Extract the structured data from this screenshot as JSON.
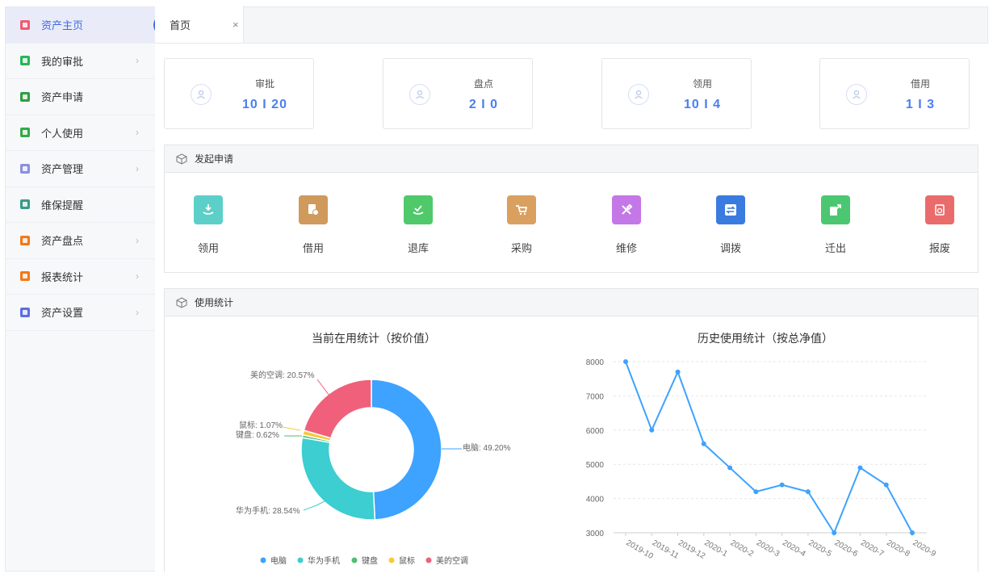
{
  "sidebar": {
    "items": [
      {
        "label": "资产主页",
        "color": "#f05b72",
        "has_chevron": false,
        "active": true
      },
      {
        "label": "我的审批",
        "color": "#27b55b",
        "has_chevron": true
      },
      {
        "label": "资产申请",
        "color": "#2f9e44",
        "has_chevron": false
      },
      {
        "label": "个人使用",
        "color": "#37a84a",
        "has_chevron": true
      },
      {
        "label": "资产管理",
        "color": "#8a8fe0",
        "has_chevron": true
      },
      {
        "label": "维保提醒",
        "color": "#3a9a8a",
        "has_chevron": false
      },
      {
        "label": "资产盘点",
        "color": "#f07a1a",
        "has_chevron": true
      },
      {
        "label": "报表统计",
        "color": "#f07a1a",
        "has_chevron": true
      },
      {
        "label": "资产设置",
        "color": "#5a6fe0",
        "has_chevron": true
      }
    ],
    "accent": "#4169e1"
  },
  "tabs": [
    {
      "title": "首页",
      "close": "×"
    }
  ],
  "stats": [
    {
      "label": "审批",
      "value": "10 I 20"
    },
    {
      "label": "盘点",
      "value": "2 I 0"
    },
    {
      "label": "领用",
      "value": "10 I 4"
    },
    {
      "label": "借用",
      "value": "1 I 3"
    }
  ],
  "apply_panel": {
    "title": "发起申请",
    "items": [
      {
        "label": "领用",
        "color": "#5ccfc8",
        "icon": "download-hand-icon"
      },
      {
        "label": "借用",
        "color": "#cf9a5c",
        "icon": "document-clock-icon"
      },
      {
        "label": "退库",
        "color": "#4fc96a",
        "icon": "return-hand-icon"
      },
      {
        "label": "采购",
        "color": "#d9a060",
        "icon": "cart-icon"
      },
      {
        "label": "维修",
        "color": "#c477e6",
        "icon": "tools-icon"
      },
      {
        "label": "调拨",
        "color": "#3a7be0",
        "icon": "transfer-icon"
      },
      {
        "label": "迁出",
        "color": "#4cc771",
        "icon": "export-icon"
      },
      {
        "label": "报废",
        "color": "#ea6b6b",
        "icon": "trash-icon"
      }
    ]
  },
  "usage_panel": {
    "title": "使用统计"
  },
  "chart_data": [
    {
      "type": "pie",
      "title": "当前在用统计（按价值）",
      "donut": true,
      "series": [
        {
          "name": "电脑",
          "value": 49.2,
          "label": "电脑: 49.20%",
          "color": "#3ea2ff"
        },
        {
          "name": "华为手机",
          "value": 28.54,
          "label": "华为手机: 28.54%",
          "color": "#3cced0"
        },
        {
          "name": "键盘",
          "value": 0.62,
          "label": "键盘: 0.62%",
          "color": "#4cc16c"
        },
        {
          "name": "鼠标",
          "value": 1.07,
          "label": "鼠标: 1.07%",
          "color": "#f7c93c"
        },
        {
          "name": "美的空调",
          "value": 20.57,
          "label": "美的空调: 20.57%",
          "color": "#f0607a"
        }
      ],
      "legend_position": "bottom"
    },
    {
      "type": "line",
      "title": "历史使用统计（按总净值）",
      "categories": [
        "2019-10",
        "2019-11",
        "2019-12",
        "2020-1",
        "2020-2",
        "2020-3",
        "2020-4",
        "2020-5",
        "2020-6",
        "2020-7",
        "2020-8",
        "2020-9"
      ],
      "values": [
        8000,
        6000,
        7700,
        5600,
        4900,
        4200,
        4400,
        4200,
        3000,
        4900,
        4400,
        3000
      ],
      "yticks": [
        3000,
        4000,
        5000,
        6000,
        7000,
        8000
      ],
      "ylim": [
        3000,
        8000
      ],
      "color": "#3ea2ff",
      "grid": true
    }
  ]
}
